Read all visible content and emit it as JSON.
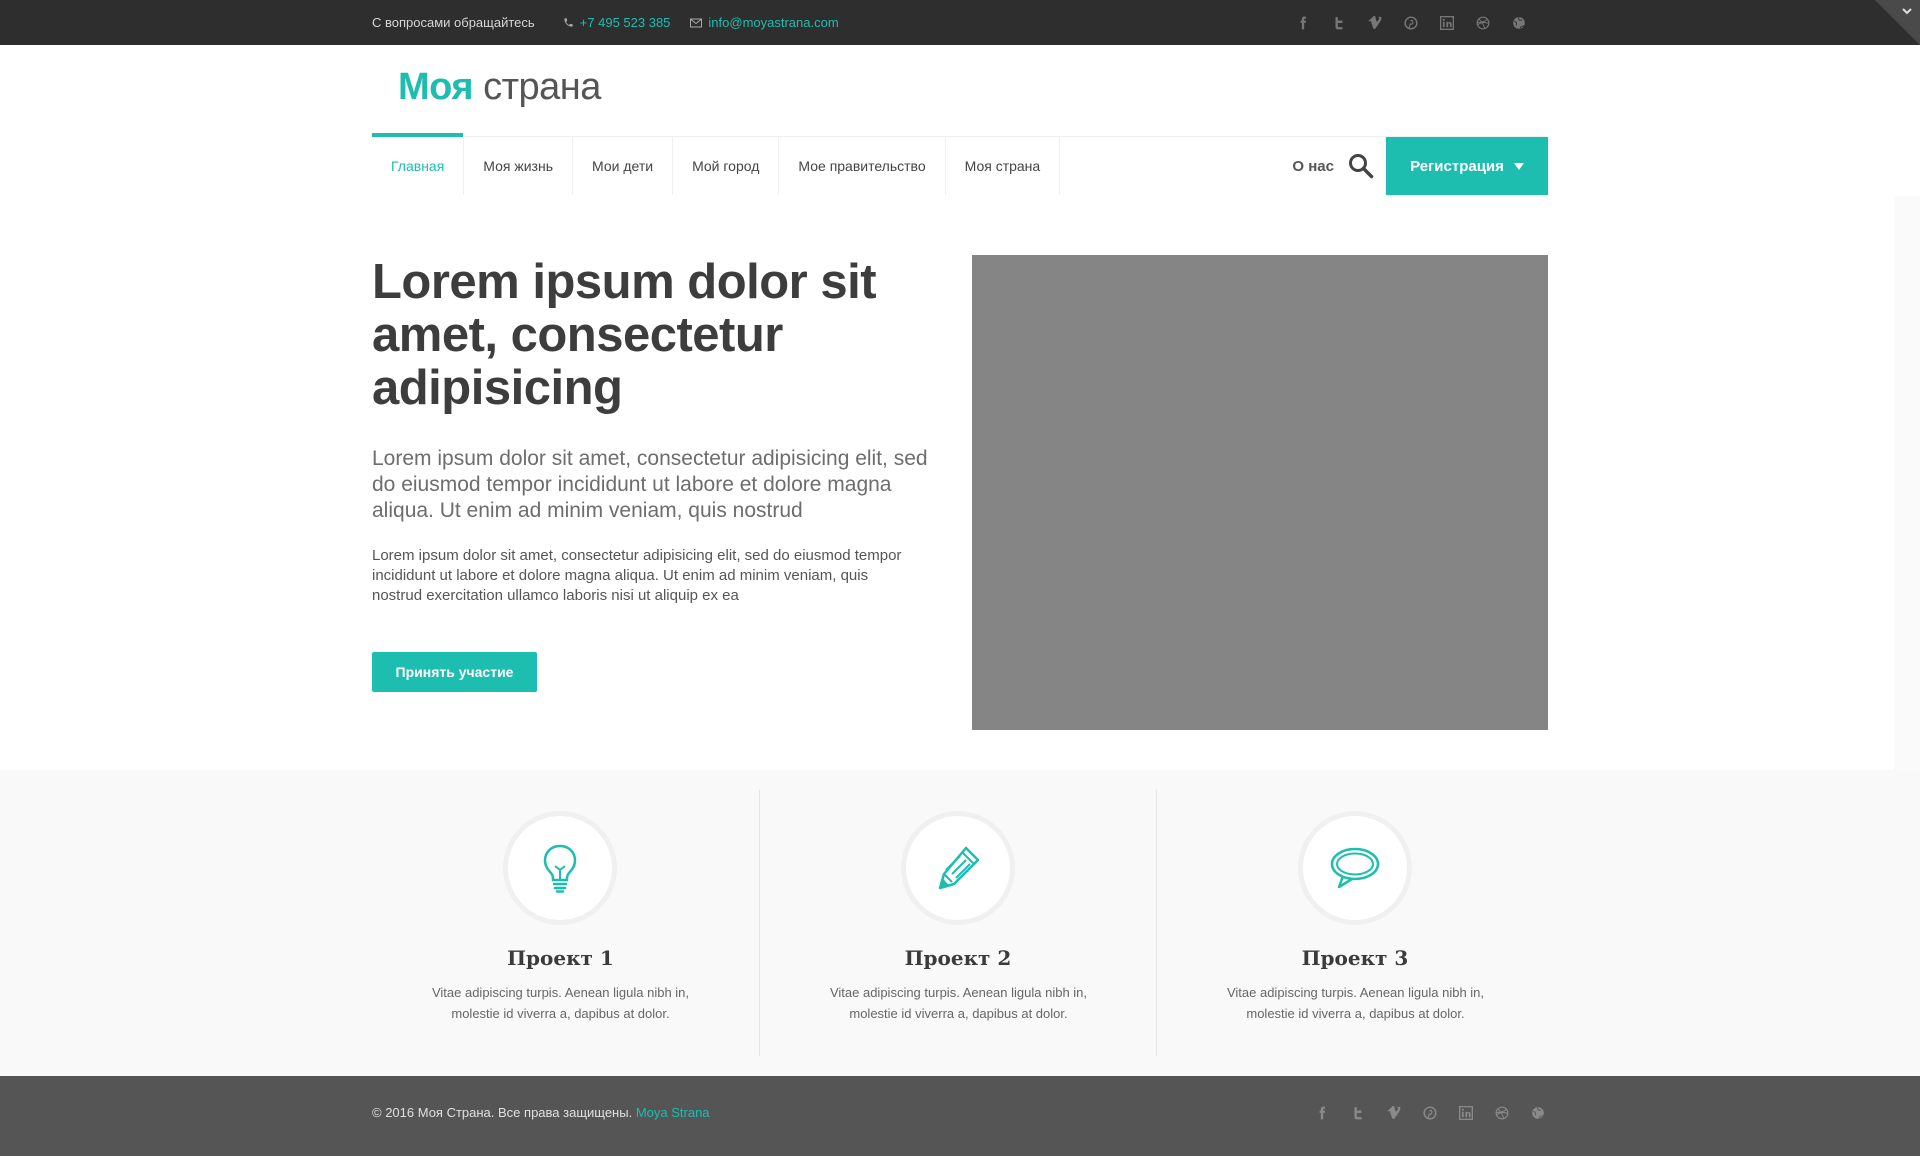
{
  "topbar": {
    "contact_label": "С вопросами обращайтесь",
    "phone": "+7 495 523 385",
    "email": "info@moyastrana.com",
    "socials": [
      "facebook-icon",
      "twitter-icon",
      "vimeo-icon",
      "pinterest-icon",
      "linkedin-icon",
      "dribbble-icon",
      "globe-icon"
    ]
  },
  "logo": {
    "bold": "Моя",
    "light": "страна"
  },
  "nav": {
    "items": [
      {
        "label": "Главная",
        "active": true
      },
      {
        "label": "Моя жизнь"
      },
      {
        "label": "Мои дети"
      },
      {
        "label": "Мой город"
      },
      {
        "label": "Мое правительство"
      },
      {
        "label": "Моя страна"
      }
    ],
    "about": "О нас",
    "register": "Регистрация"
  },
  "hero": {
    "title": "Lorem ipsum dolor sit amet, consectetur adipisicing",
    "lead": "Lorem ipsum dolor sit amet, consectetur adipisicing elit, sed do eiusmod tempor incididunt ut labore et dolore magna aliqua. Ut enim ad minim veniam, quis nostrud",
    "text": "Lorem ipsum dolor sit amet, consectetur adipisicing elit, sed do eiusmod tempor incididunt ut labore et dolore magna aliqua. Ut enim ad minim veniam, quis nostrud exercitation ullamco laboris nisi ut aliquip ex ea",
    "cta": "Принять участие"
  },
  "projects": [
    {
      "icon": "lightbulb-icon",
      "title": "Проект 1",
      "text": "Vitae adipiscing turpis. Aenean ligula nibh in, molestie id viverra a, dapibus at dolor."
    },
    {
      "icon": "pencil-icon",
      "title": "Проект 2",
      "text": "Vitae adipiscing turpis. Aenean ligula nibh in, molestie id viverra a, dapibus at dolor."
    },
    {
      "icon": "speech-bubble-icon",
      "title": "Проект 3",
      "text": "Vitae adipiscing turpis. Aenean ligula nibh in, molestie id viverra a, dapibus at dolor."
    }
  ],
  "footer": {
    "copyright": "© 2016 Моя Страна. Все права защищены.",
    "brand": "Moya Strana"
  },
  "colors": {
    "accent": "#1dbdb0",
    "topbar": "#2e2e2e",
    "footer": "#555555",
    "placeholder": "#858585"
  }
}
